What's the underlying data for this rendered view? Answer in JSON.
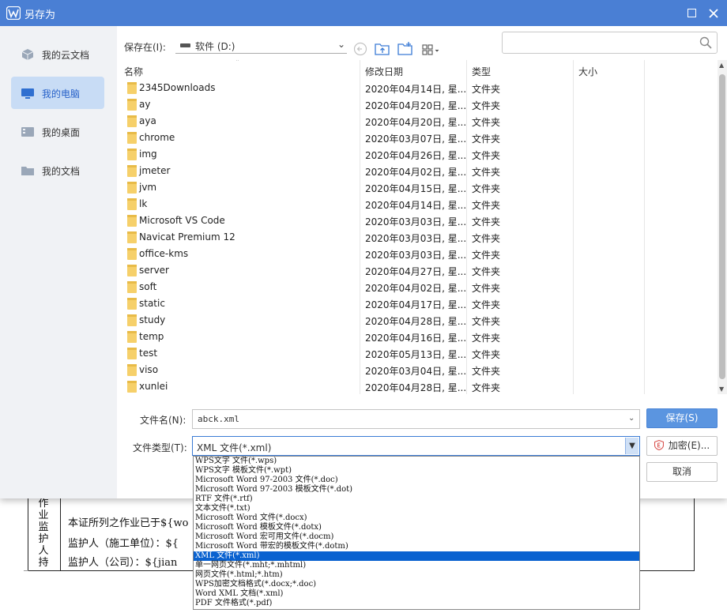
{
  "window": {
    "title": "另存为"
  },
  "sidebar": {
    "items": [
      {
        "label": "我的云文档",
        "icon": "cloud-doc-icon",
        "active": false
      },
      {
        "label": "我的电脑",
        "icon": "computer-icon",
        "active": true
      },
      {
        "label": "我的桌面",
        "icon": "desktop-icon",
        "active": false
      },
      {
        "label": "我的文档",
        "icon": "folder-icon",
        "active": false
      }
    ]
  },
  "toolbar": {
    "save_in_label": "保存在(I):",
    "location": "软件 (D:)",
    "search_placeholder": ""
  },
  "file_list": {
    "columns": [
      "名称",
      "修改日期",
      "类型",
      "大小"
    ],
    "rows": [
      {
        "name": "2345Downloads",
        "date": "2020年04月14日, 星...",
        "type": "文件夹"
      },
      {
        "name": "ay",
        "date": "2020年04月20日, 星...",
        "type": "文件夹"
      },
      {
        "name": "aya",
        "date": "2020年04月20日, 星...",
        "type": "文件夹"
      },
      {
        "name": "chrome",
        "date": "2020年03月07日, 星...",
        "type": "文件夹"
      },
      {
        "name": "img",
        "date": "2020年04月26日, 星...",
        "type": "文件夹"
      },
      {
        "name": "jmeter",
        "date": "2020年04月02日, 星...",
        "type": "文件夹"
      },
      {
        "name": "jvm",
        "date": "2020年04月15日, 星...",
        "type": "文件夹"
      },
      {
        "name": "lk",
        "date": "2020年04月14日, 星...",
        "type": "文件夹"
      },
      {
        "name": "Microsoft VS Code",
        "date": "2020年03月03日, 星...",
        "type": "文件夹"
      },
      {
        "name": "Navicat Premium 12",
        "date": "2020年03月03日, 星...",
        "type": "文件夹"
      },
      {
        "name": "office-kms",
        "date": "2020年03月03日, 星...",
        "type": "文件夹"
      },
      {
        "name": "server",
        "date": "2020年04月27日, 星...",
        "type": "文件夹"
      },
      {
        "name": "soft",
        "date": "2020年04月02日, 星...",
        "type": "文件夹"
      },
      {
        "name": "static",
        "date": "2020年04月17日, 星...",
        "type": "文件夹"
      },
      {
        "name": "study",
        "date": "2020年04月28日, 星...",
        "type": "文件夹"
      },
      {
        "name": "temp",
        "date": "2020年04月16日, 星...",
        "type": "文件夹"
      },
      {
        "name": "test",
        "date": "2020年05月13日, 星...",
        "type": "文件夹"
      },
      {
        "name": "viso",
        "date": "2020年03月04日, 星...",
        "type": "文件夹"
      },
      {
        "name": "xunlei",
        "date": "2020年04月28日, 星...",
        "type": "文件夹"
      }
    ]
  },
  "form": {
    "filename_label": "文件名(N):",
    "filename_value": "abck.xml",
    "filetype_label": "文件类型(T):",
    "filetype_value": "XML 文件(*.xml)"
  },
  "buttons": {
    "save": "保存(S)",
    "encrypt": "加密(E)...",
    "cancel": "取消"
  },
  "filetype_options": [
    "WPS文字 文件(*.wps)",
    "WPS文字 模板文件(*.wpt)",
    "Microsoft Word 97-2003 文件(*.doc)",
    "Microsoft Word 97-2003 模板文件(*.dot)",
    "RTF 文件(*.rtf)",
    "文本文件(*.txt)",
    "Microsoft Word 文件(*.docx)",
    "Microsoft Word 模板文件(*.dotx)",
    "Microsoft Word 宏可用文件(*.docm)",
    "Microsoft Word 带宏的模板文件(*.dotm)",
    "XML 文件(*.xml)",
    "单一网页文件(*.mht;*.mhtml)",
    "网页文件(*.html;*.htm)",
    "WPS加密文档格式(*.docx;*.doc)",
    "Word XML 文档(*.xml)",
    "PDF 文件格式(*.pdf)"
  ],
  "selected_filetype_index": 10,
  "background_doc": {
    "vertical_label": "作业监护人持",
    "line1": "本证所列之作业已于${wo",
    "line2": "监护人（施工单位）：${",
    "line3": "监护人（公司）：${jian"
  },
  "colors": {
    "titlebar": "#4a7fd4",
    "accent": "#2862c9",
    "selection": "#0a62d0",
    "folder": "#f6d06a"
  }
}
